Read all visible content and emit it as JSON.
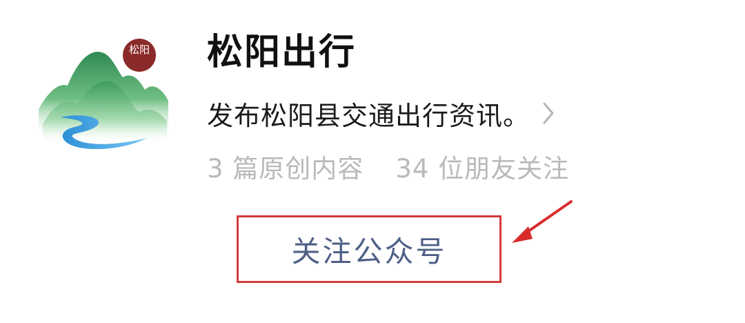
{
  "account": {
    "logo_seal_text": "松阳",
    "name": "松阳出行",
    "description": "发布松阳县交通出行资讯。",
    "stats": {
      "original_content": "3 篇原创内容",
      "friends_following": "34 位朋友关注"
    }
  },
  "actions": {
    "follow_label": "关注公众号"
  },
  "annotation": {
    "highlight_color": "#d23a3a"
  },
  "icons": {
    "description_chevron": "chevron-right-icon",
    "annotation_arrow": "red-arrow-icon"
  }
}
